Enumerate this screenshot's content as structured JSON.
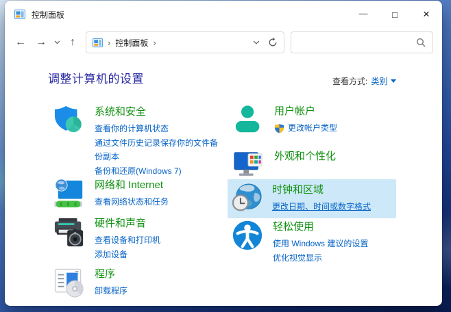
{
  "colors": {
    "category_title": "#119111",
    "link": "#0663c7",
    "heading": "#2727a4",
    "highlight": "#cde8f8",
    "window_bg": "#ffffff",
    "text_dark": "#1b1b1b"
  },
  "titlebar": {
    "title": "控制面板"
  },
  "window_controls": {
    "minimize": "—",
    "maximize": "□",
    "close": "×"
  },
  "navbar": {
    "glyphs": {
      "back": "←",
      "forward": "→",
      "up": "↑",
      "crumb_sep": "›"
    },
    "breadcrumb": {
      "root": "控制面板"
    },
    "search": {
      "value": ""
    }
  },
  "header": {
    "title": "调整计算机的设置",
    "view_by_label": "查看方式:",
    "view_by_value": "类别"
  },
  "categories": {
    "left": [
      {
        "title": "系统和安全",
        "links": [
          "查看你的计算机状态",
          "通过文件历史记录保存你的文件备份副本",
          "备份和还原(Windows 7)"
        ]
      },
      {
        "title": "网络和 Internet",
        "links": [
          "查看网络状态和任务"
        ]
      },
      {
        "title": "硬件和声音",
        "links": [
          "查看设备和打印机",
          "添加设备"
        ]
      },
      {
        "title": "程序",
        "links": [
          "卸载程序"
        ]
      }
    ],
    "right": [
      {
        "title": "用户帐户",
        "links": [
          "更改帐户类型"
        ]
      },
      {
        "title": "外观和个性化",
        "links": []
      },
      {
        "title": "时钟和区域",
        "links": [
          "更改日期、时间或数字格式"
        ],
        "highlighted": true
      },
      {
        "title": "轻松使用",
        "links": [
          "使用 Windows 建议的设置",
          "优化视觉显示"
        ]
      }
    ]
  }
}
